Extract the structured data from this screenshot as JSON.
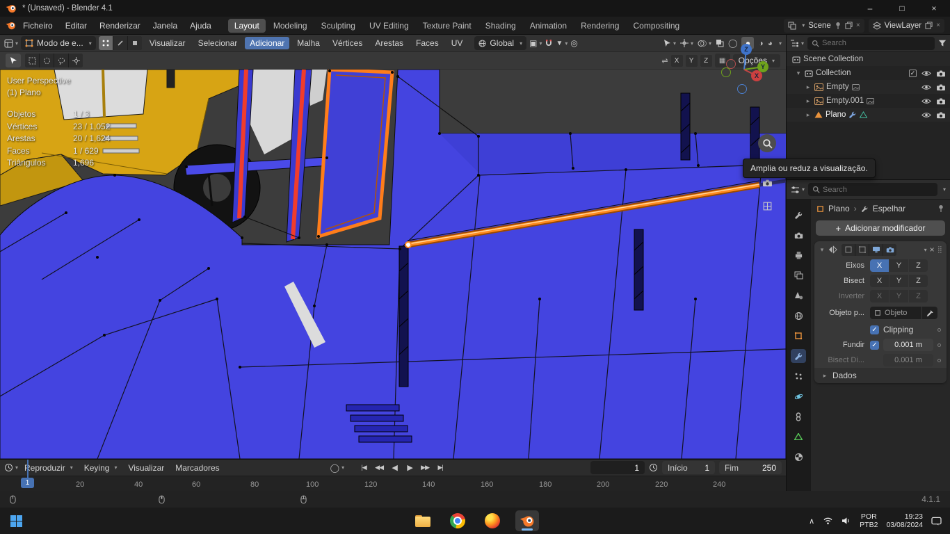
{
  "colors": {
    "accent_blue": "#4772b3",
    "selection_orange": "#ff8a1e",
    "edge_red": "#f03c2c",
    "mesh_blue": "#4444e0",
    "machine_yellow": "#d7a414"
  },
  "titlebar": {
    "title": "* (Unsaved) - Blender 4.1"
  },
  "menubar": {
    "menus": [
      "Ficheiro",
      "Editar",
      "Renderizar",
      "Janela",
      "Ajuda"
    ],
    "workspaces": [
      "Layout",
      "Modeling",
      "Sculpting",
      "UV Editing",
      "Texture Paint",
      "Shading",
      "Animation",
      "Rendering",
      "Compositing"
    ],
    "scene": "Scene",
    "view_layer": "ViewLayer"
  },
  "viewport_header": {
    "mode": "Modo de e...",
    "menus": [
      "Visualizar",
      "Selecionar",
      "Adicionar",
      "Malha",
      "Vértices",
      "Arestas",
      "Faces",
      "UV"
    ],
    "orientation": "Global",
    "axes": [
      "X",
      "Y",
      "Z"
    ],
    "options": "Opções"
  },
  "viewport": {
    "view_label": "User Perspective",
    "object_label": "(1) Plano",
    "stats": [
      {
        "label": "Objetos",
        "value": "1 / 3"
      },
      {
        "label": "Vértices",
        "value": "23 / 1,052"
      },
      {
        "label": "Arestas",
        "value": "20 / 1,624"
      },
      {
        "label": "Faces",
        "value": "1 / 629"
      },
      {
        "label": "Triângulos",
        "value": "1,696"
      }
    ],
    "tooltip": "Amplia ou reduz a visualização.",
    "gizmo": {
      "x": "X",
      "y": "Y",
      "z": "Z"
    }
  },
  "outliner": {
    "search_placeholder": "Search",
    "rows": [
      {
        "label": "Scene Collection"
      },
      {
        "label": "Collection"
      },
      {
        "label": "Empty"
      },
      {
        "label": "Empty.001"
      },
      {
        "label": "Plano"
      }
    ]
  },
  "properties": {
    "search_placeholder": "Search",
    "breadcrumb": {
      "object": "Plano",
      "modifier": "Espelhar"
    },
    "add_modifier": "Adicionar modificador",
    "mirror": {
      "axes": [
        "X",
        "Y",
        "Z"
      ],
      "axes_label": "Eixos",
      "bisect_label": "Bisect",
      "flip_label": "Inverter",
      "object_label": "Objeto p...",
      "object_value": "Objeto",
      "clipping_label": "Clipping",
      "merge_label": "Fundir",
      "merge_value": "0.001 m",
      "bisect_dist_label": "Bisect Di...",
      "bisect_dist_value": "0.001 m",
      "data_label": "Dados"
    }
  },
  "timeline": {
    "menus": [
      "Reproduzir",
      "Keying",
      "Visualizar",
      "Marcadores"
    ],
    "current_frame": "1",
    "start_label": "Início",
    "start_value": "1",
    "end_label": "Fim",
    "end_value": "250",
    "playhead": "1",
    "ruler": [
      "20",
      "40",
      "60",
      "80",
      "100",
      "120",
      "140",
      "160",
      "180",
      "200",
      "220",
      "240"
    ]
  },
  "statusbar": {
    "version": "4.1.1"
  },
  "taskbar": {
    "lang_top": "POR",
    "lang_bottom": "PTB2",
    "time": "19:23",
    "date": "03/08/2024"
  }
}
